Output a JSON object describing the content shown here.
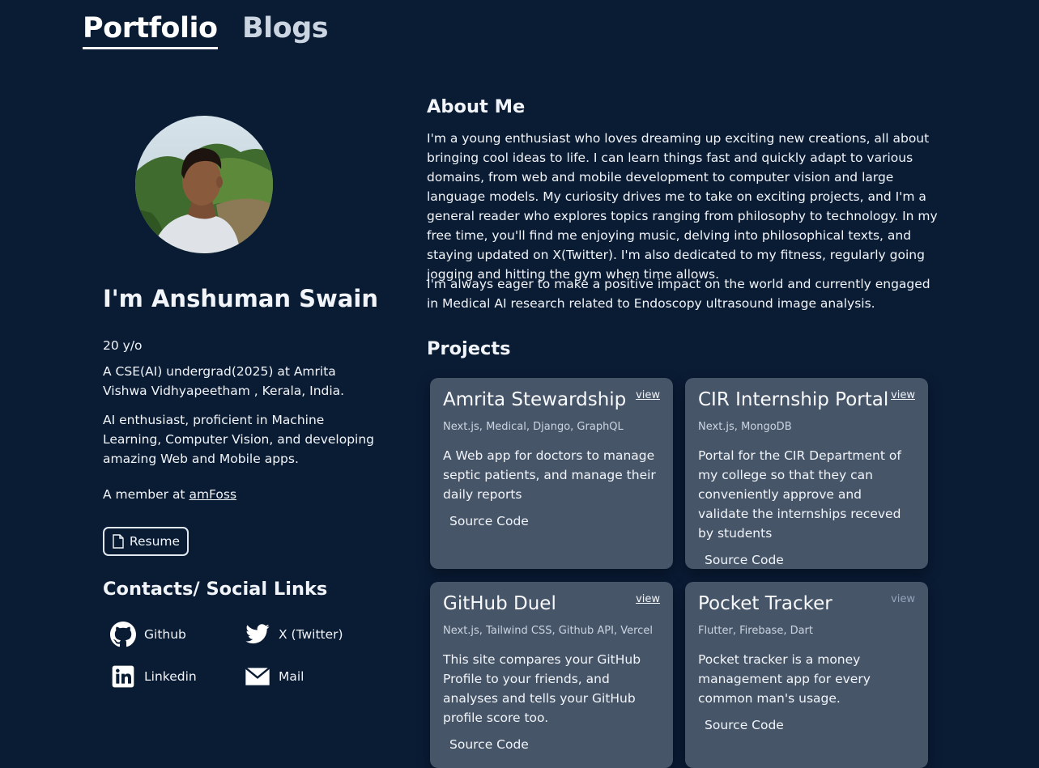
{
  "nav": {
    "tabs": [
      {
        "label": "Portfolio",
        "active": true
      },
      {
        "label": "Blogs",
        "active": false
      }
    ]
  },
  "profile": {
    "name": "I'm Anshuman Swain",
    "age": "20 y/o",
    "education": "A CSE(AI) undergrad(2025) at Amrita Vishwa Vidhyapeetham , Kerala, India.",
    "interests": "AI enthusiast, proficient in Machine Learning, Computer Vision, and developing amazing Web and Mobile apps.",
    "member_prefix": "A member at ",
    "member_link": "amFoss",
    "resume_label": "Resume"
  },
  "contacts": {
    "title": "Contacts/ Social Links",
    "links": [
      {
        "label": "Github",
        "icon": "github-icon"
      },
      {
        "label": "X (Twitter)",
        "icon": "twitter-icon"
      },
      {
        "label": "Linkedin",
        "icon": "linkedin-icon"
      },
      {
        "label": "Mail",
        "icon": "mail-icon"
      }
    ]
  },
  "about": {
    "title": "About Me",
    "paragraphs": [
      "I'm a young enthusiast who loves dreaming up exciting new creations, all about bringing cool ideas to life. I can learn things fast and quickly adapt to various domains, from web and mobile development to computer vision and large language models. My curiosity drives me to take on exciting projects, and I'm a general reader who explores topics ranging from philosophy to technology. In my free time, you'll find me enjoying music, delving into philosophical texts, and staying updated on X(Twitter). I'm also dedicated to my fitness, regularly going jogging and hitting the gym when time allows.",
      "I'm always eager to make a positive impact on the world and currently engaged in Medical AI research related to Endoscopy ultrasound image analysis."
    ]
  },
  "projects": {
    "title": "Projects",
    "items": [
      {
        "title": "Amrita Stewardship",
        "view": "view",
        "tags": "Next.js, Medical, Django, GraphQL",
        "description": "A Web app for doctors to manage septic patients, and manage their daily reports",
        "source": "Source Code"
      },
      {
        "title": "CIR Internship Portal",
        "view": "view",
        "tags": "Next.js, MongoDB",
        "description": "Portal for the CIR Department of my college so that they can conveniently approve and validate the internships receved by students",
        "source": "Source Code"
      },
      {
        "title": "GitHub Duel",
        "view": "view",
        "tags": "Next.js, Tailwind CSS, Github API, Vercel",
        "description": "This site compares your GitHub Profile to your friends, and analyses and tells your GitHub profile score too.",
        "source": "Source Code"
      },
      {
        "title": "Pocket Tracker",
        "view": "view",
        "tags": "Flutter, Firebase, Dart",
        "description": "Pocket tracker is a money management app for every common man's usage.",
        "source": "Source Code"
      }
    ]
  },
  "colors": {
    "background": "#0a1b34",
    "card": "#475569",
    "text": "#f1f5f9"
  }
}
